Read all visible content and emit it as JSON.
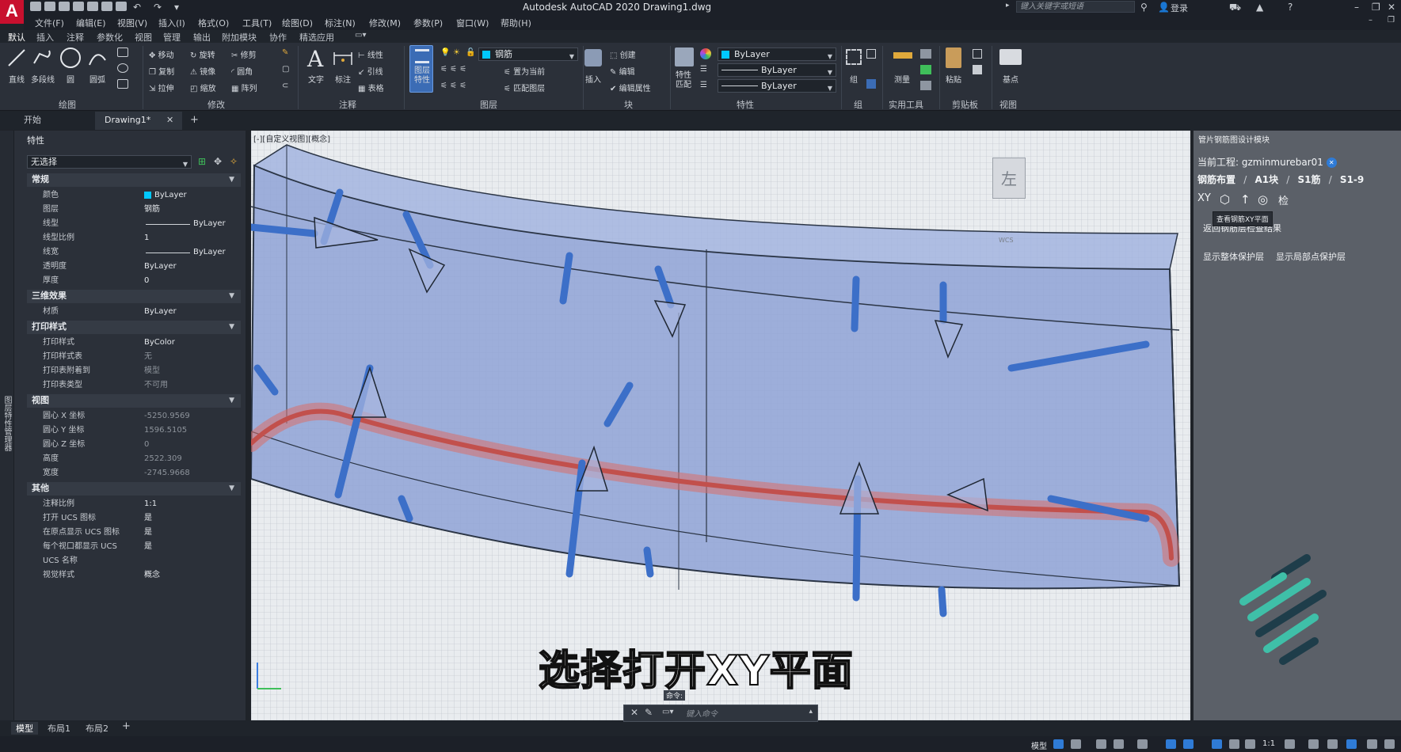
{
  "app": {
    "logo_letter": "A",
    "title": "Autodesk AutoCAD 2020    Drawing1.dwg",
    "search_placeholder": "键入关键字或短语",
    "login": "登录"
  },
  "menu": [
    "文件(F)",
    "编辑(E)",
    "视图(V)",
    "插入(I)",
    "格式(O)",
    "工具(T)",
    "绘图(D)",
    "标注(N)",
    "修改(M)",
    "参数(P)",
    "窗口(W)",
    "帮助(H)"
  ],
  "ribbon_tabs": [
    "默认",
    "插入",
    "注释",
    "参数化",
    "视图",
    "管理",
    "输出",
    "附加模块",
    "协作",
    "精选应用"
  ],
  "ribbon": {
    "draw": {
      "line": "直线",
      "polyline": "多段线",
      "circle": "圆",
      "arc": "圆弧",
      "label": "绘图"
    },
    "modify": {
      "move": "移动",
      "rotate": "旋转",
      "trim": "修剪",
      "copy": "复制",
      "mirror": "镜像",
      "fillet": "圆角",
      "stretch": "拉伸",
      "scale": "缩放",
      "array": "阵列",
      "label": "修改"
    },
    "annotation": {
      "text": "文字",
      "dimension": "标注",
      "linear": "线性",
      "leader": "引线",
      "table": "表格",
      "label": "注释"
    },
    "layers": {
      "props": "图层\n特性",
      "current_layer": "钢筋",
      "set_current": "置为当前",
      "match_layer": "匹配图层",
      "label": "图层"
    },
    "block": {
      "insert": "插入",
      "create": "创建",
      "edit": "编辑",
      "edit_attr": "编辑属性",
      "label": "块"
    },
    "properties": {
      "match": "特性\n匹配",
      "color": "ByLayer",
      "linetype": "ByLayer",
      "lineweight": "ByLayer",
      "label": "特性"
    },
    "groups": {
      "group": "组",
      "label": "组"
    },
    "utilities": {
      "measure": "测量",
      "label": "实用工具"
    },
    "clipboard": {
      "paste": "粘贴",
      "label": "剪贴板"
    },
    "view": {
      "base": "基点",
      "label": "视图"
    }
  },
  "doc_tabs": [
    "开始",
    "Drawing1*"
  ],
  "properties_panel": {
    "strip_label": "图层特性管理器",
    "title": "特性",
    "selection": "无选择",
    "sections": [
      {
        "name": "常规",
        "rows": [
          {
            "k": "颜色",
            "v": "ByLayer"
          },
          {
            "k": "图层",
            "v": "钢筋"
          },
          {
            "k": "线型",
            "v": "ByLayer"
          },
          {
            "k": "线型比例",
            "v": "1"
          },
          {
            "k": "线宽",
            "v": "ByLayer"
          },
          {
            "k": "透明度",
            "v": "ByLayer"
          },
          {
            "k": "厚度",
            "v": "0"
          }
        ]
      },
      {
        "name": "三维效果",
        "rows": [
          {
            "k": "材质",
            "v": "ByLayer"
          }
        ]
      },
      {
        "name": "打印样式",
        "rows": [
          {
            "k": "打印样式",
            "v": "ByColor"
          },
          {
            "k": "打印样式表",
            "v": "无"
          },
          {
            "k": "打印表附着到",
            "v": "模型"
          },
          {
            "k": "打印表类型",
            "v": "不可用"
          }
        ]
      },
      {
        "name": "视图",
        "rows": [
          {
            "k": "圆心 X 坐标",
            "v": "-5250.9569"
          },
          {
            "k": "圆心 Y 坐标",
            "v": "1596.5105"
          },
          {
            "k": "圆心 Z 坐标",
            "v": "0"
          },
          {
            "k": "高度",
            "v": "2522.309"
          },
          {
            "k": "宽度",
            "v": "-2745.9668"
          }
        ]
      },
      {
        "name": "其他",
        "rows": [
          {
            "k": "注释比例",
            "v": "1:1"
          },
          {
            "k": "打开 UCS 图标",
            "v": "是"
          },
          {
            "k": "在原点显示 UCS 图标",
            "v": "是"
          },
          {
            "k": "每个视口都显示 UCS",
            "v": "是"
          },
          {
            "k": "UCS 名称",
            "v": ""
          },
          {
            "k": "视觉样式",
            "v": "概念"
          }
        ]
      }
    ]
  },
  "viewport": {
    "label": "[-][自定义视图][概念]",
    "subtitle": "选择打开XY平面",
    "viewcube": "左",
    "wcs": "WCS",
    "cmd_tip": "命令:",
    "cmd_placeholder": "键入命令"
  },
  "right_panel": {
    "title": "管片钢筋图设计模块",
    "project_label": "当前工程:",
    "project_name": "gzminmurebar01",
    "crumb": [
      "钢筋布置",
      "A1块",
      "S1筋",
      "S1-9"
    ],
    "icon_xy": "XY",
    "icon_check": "检",
    "tooltip": "查看钢筋XY平面",
    "return_btn": "返回钢筋层检查结果",
    "btn_whole": "显示整体保护层",
    "btn_local": "显示局部点保护层"
  },
  "layout_tabs": [
    "模型",
    "布局1",
    "布局2"
  ],
  "status": {
    "model": "模型",
    "scale": "1:1"
  },
  "colors": {
    "accent_blue": "#2f7bd6",
    "layer_cyan": "#00c8ff",
    "rebar_blue": "#3c6fc8",
    "pipe_red": "#d9706a",
    "segment_fill": "#8fa3d6",
    "brand_teal": "#3fbfa8"
  }
}
